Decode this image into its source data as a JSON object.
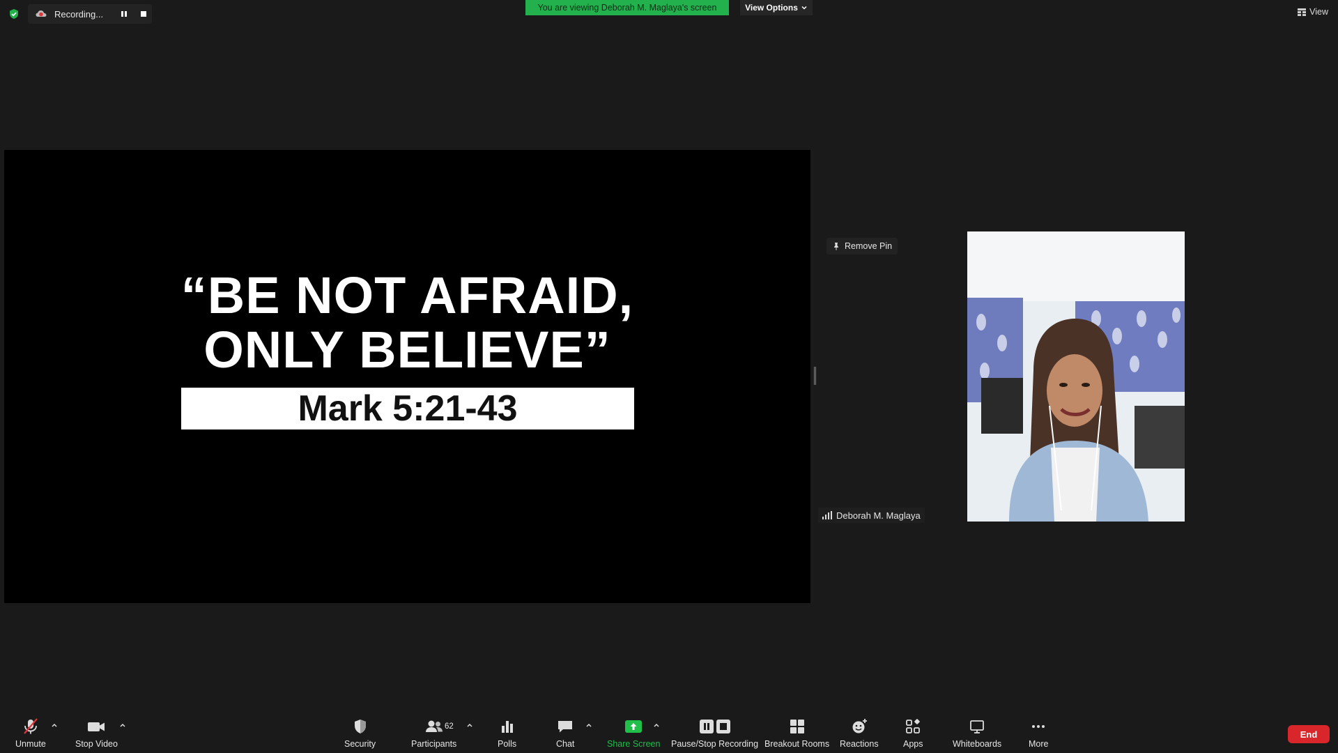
{
  "top_bar": {
    "recording_label": "Recording...",
    "viewing_banner": "You are viewing Deborah M. Maglaya's screen",
    "view_options_label": "View Options",
    "view_label": "View"
  },
  "shared_screen": {
    "slide_title_line1": "“BE NOT AFRAID,",
    "slide_title_line2": "ONLY BELIEVE”",
    "slide_reference": "Mark 5:21-43"
  },
  "video_panel": {
    "remove_pin_label": "Remove Pin",
    "participant_name": "Deborah M. Maglaya"
  },
  "toolbar": {
    "unmute_label": "Unmute",
    "stop_video_label": "Stop Video",
    "security_label": "Security",
    "participants_label": "Participants",
    "participants_count": "62",
    "polls_label": "Polls",
    "chat_label": "Chat",
    "share_screen_label": "Share Screen",
    "pause_stop_recording_label": "Pause/Stop Recording",
    "breakout_rooms_label": "Breakout Rooms",
    "reactions_label": "Reactions",
    "apps_label": "Apps",
    "whiteboards_label": "Whiteboards",
    "more_label": "More",
    "end_label": "End"
  },
  "colors": {
    "background": "#1a1a1a",
    "banner_green": "#22b14c",
    "share_green": "#1fbf4a",
    "end_red": "#d9262b"
  },
  "icons": [
    "shield-check-icon",
    "cloud-record-icon",
    "pause-icon",
    "stop-icon",
    "chevron-down-icon",
    "grid-view-icon",
    "pin-icon",
    "signal-icon",
    "mic-muted-icon",
    "camera-icon",
    "security-shield-icon",
    "participants-icon",
    "polls-icon",
    "chat-icon",
    "share-screen-icon",
    "pause-stop-recording-icon",
    "breakout-rooms-icon",
    "reactions-icon",
    "apps-icon",
    "whiteboards-icon",
    "more-icon"
  ]
}
